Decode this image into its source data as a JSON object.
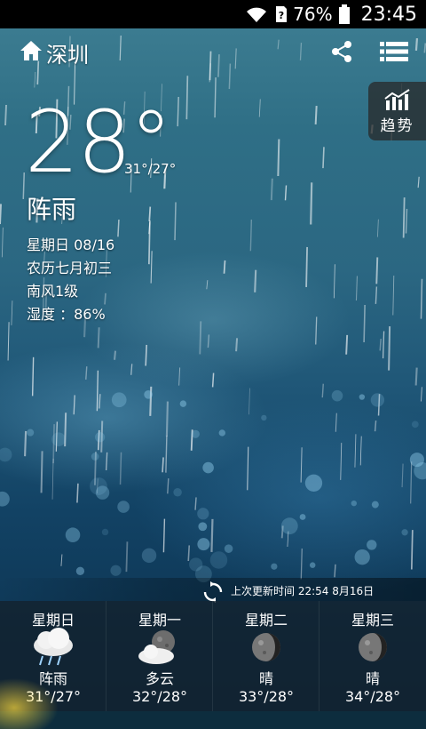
{
  "status_bar": {
    "battery_percent": "76%",
    "time": "23:45"
  },
  "header": {
    "city": "深圳",
    "trend_label": "趋势"
  },
  "current": {
    "temperature": "28°",
    "range": "31°/27°",
    "condition": "阵雨",
    "date": "星期日 08/16",
    "lunar_date": "农历七月初三",
    "wind": "南风1级",
    "humidity": "湿度 ：86%"
  },
  "update": {
    "text": "上次更新时间 22:54 8月16日"
  },
  "forecast": [
    {
      "day": "星期日",
      "icon": "rain-cloud-icon",
      "condition": "阵雨",
      "temp": "31°/27°"
    },
    {
      "day": "星期一",
      "icon": "moon-cloud-icon",
      "condition": "多云",
      "temp": "32°/28°"
    },
    {
      "day": "星期二",
      "icon": "moon-icon",
      "condition": "晴",
      "temp": "33°/28°"
    },
    {
      "day": "星期三",
      "icon": "moon-icon",
      "condition": "晴",
      "temp": "34°/28°"
    }
  ]
}
